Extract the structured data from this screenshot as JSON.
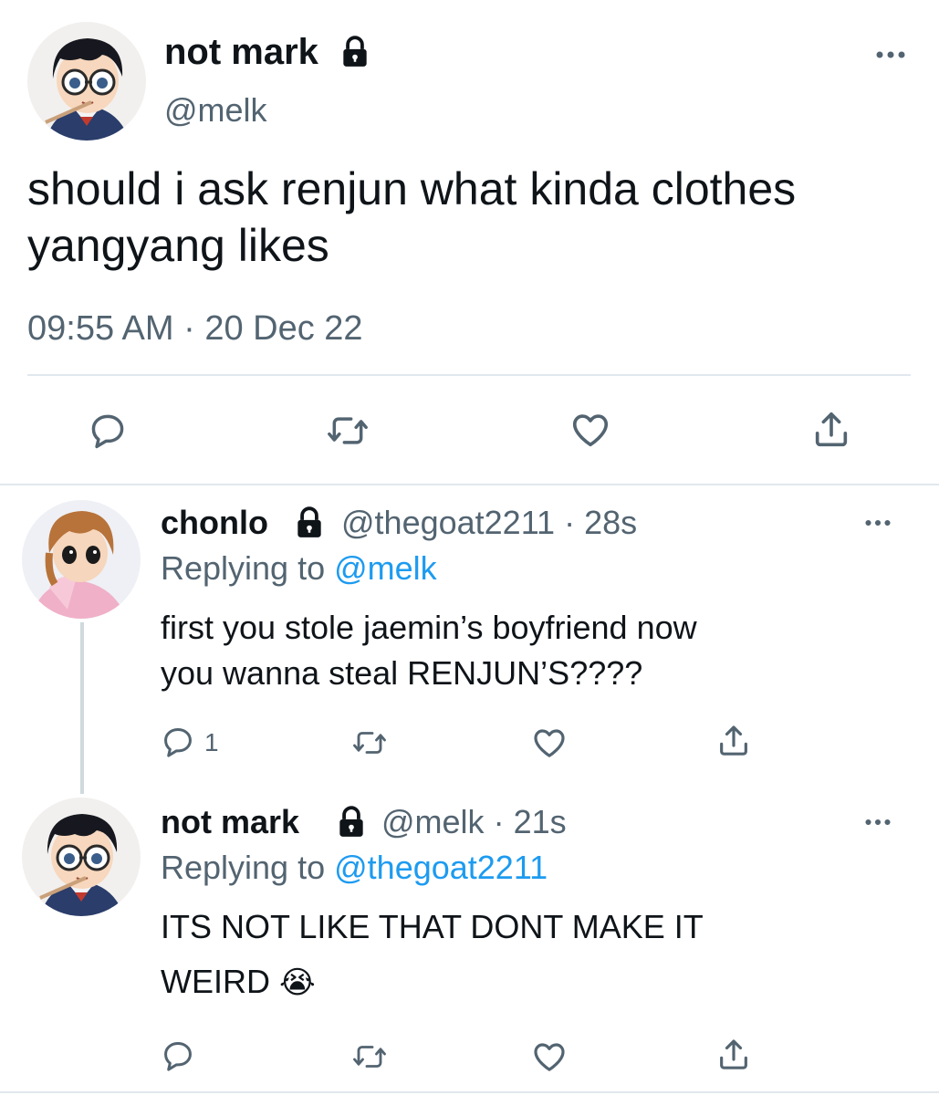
{
  "main_tweet": {
    "display_name": "not mark",
    "handle": "@melk",
    "text_line1": "should i ask renjun what kinda clothes",
    "text_line2": "yangyang likes",
    "time": "09:55 AM",
    "separator": "·",
    "date": "20 Dec 22",
    "avatar_icon": "anime-boy-glasses-avatar",
    "verified_lock_icon": "lock-icon"
  },
  "reply1": {
    "display_name": "chonlo",
    "handle": "@thegoat2211",
    "age": "· 28s",
    "replying_prefix": "Replying to",
    "replying_to": "@melk",
    "text_line1": "first you stole jaemin’s boyfriend now",
    "text_line2": "you wanna steal RENJUN’S????",
    "reply_count": "1",
    "avatar_icon": "anime-girl-avatar"
  },
  "reply2": {
    "display_name": "not mark",
    "handle": "@melk",
    "age": "· 21s",
    "replying_prefix": "Replying to",
    "replying_to": "@thegoat2211",
    "text_line1": "ITS NOT LIKE THAT DONT MAKE IT",
    "text_line2": "WEIRD",
    "emoji": "😭",
    "avatar_icon": "anime-boy-glasses-avatar"
  },
  "colors": {
    "text": "#0f1419",
    "secondary": "#536471",
    "link": "#1d9bf0",
    "divider": "#e1e8ed"
  }
}
